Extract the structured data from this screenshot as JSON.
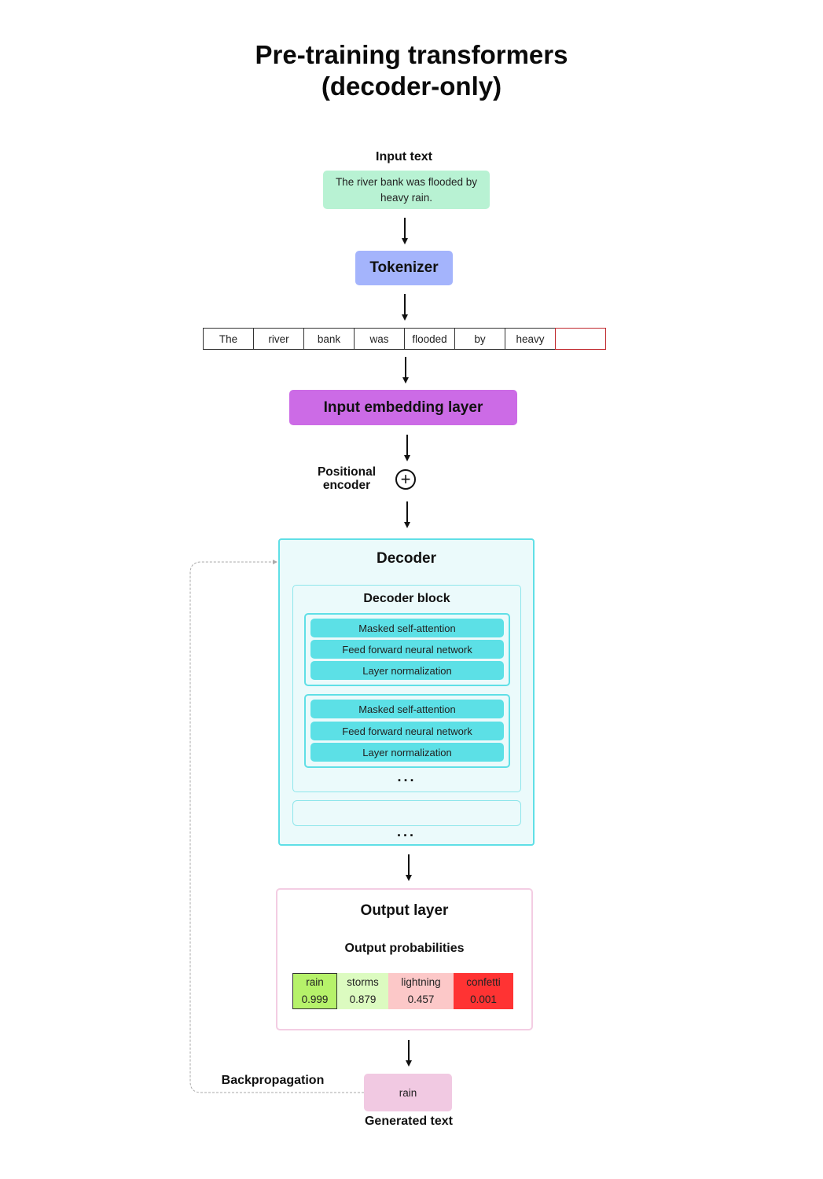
{
  "title": {
    "line1": "Pre-training transformers",
    "line2": "(decoder-only)"
  },
  "input": {
    "label": "Input text",
    "text": "The river bank was flooded by heavy rain."
  },
  "tokenizer": {
    "label": "Tokenizer"
  },
  "tokens": [
    "The",
    "river",
    "bank",
    "was",
    "flooded",
    "by",
    "heavy",
    ""
  ],
  "embedding": {
    "label": "Input embedding layer"
  },
  "positional_encoder": {
    "label": "Positional encoder",
    "icon": "plus-circle-icon",
    "symbol": "+"
  },
  "decoder": {
    "title": "Decoder",
    "block_title": "Decoder block",
    "sub_blocks": [
      {
        "layers": [
          "Masked self-attention",
          "Feed forward neural network",
          "Layer normalization"
        ]
      },
      {
        "layers": [
          "Masked self-attention",
          "Feed forward neural network",
          "Layer normalization"
        ]
      }
    ],
    "inner_ellipsis": "...",
    "outer_ellipsis": "..."
  },
  "output_layer": {
    "title": "Output layer",
    "subtitle": "Output probabilities",
    "probabilities": [
      {
        "word": "rain",
        "value": "0.999",
        "color": "#b6f26a"
      },
      {
        "word": "storms",
        "value": "0.879",
        "color": "#dcfbc0"
      },
      {
        "word": "lightning",
        "value": "0.457",
        "color": "#fcc8c8"
      },
      {
        "word": "confetti",
        "value": "0.001",
        "color": "#ff3333"
      }
    ]
  },
  "generated": {
    "text": "rain",
    "label": "Generated text"
  },
  "backpropagation": {
    "label": "Backpropagation"
  },
  "colors": {
    "input_text_bg": "#b8f2d3",
    "tokenizer_bg": "#a4b4fc",
    "embedding_bg": "#cc6be6",
    "decoder_border": "#5fdfe6",
    "decoder_bg": "#ebfafb",
    "layer_bg": "#5ce0e6",
    "output_border": "#f3cde3",
    "generated_bg": "#f1c9e2",
    "empty_token_border": "#c0282d"
  }
}
